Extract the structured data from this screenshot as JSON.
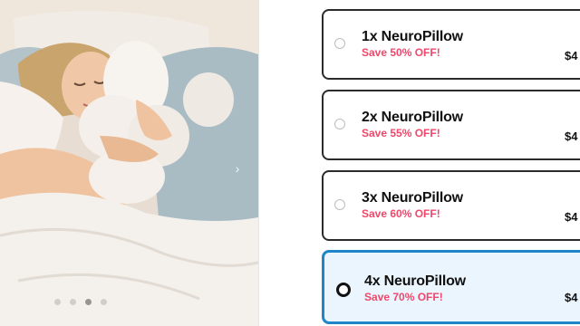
{
  "gallery": {
    "next_arrow": "›",
    "dots": [
      "",
      "",
      "",
      ""
    ],
    "active_dot": 2
  },
  "offers": [
    {
      "title": "1x NeuroPillow",
      "save": "Save 50% OFF!",
      "price": "$4",
      "selected": false
    },
    {
      "title": "2x NeuroPillow",
      "save": "Save 55% OFF!",
      "price": "$4",
      "selected": false
    },
    {
      "title": "3x NeuroPillow",
      "save": "Save 60% OFF!",
      "price": "$4",
      "selected": false
    },
    {
      "title": "4x NeuroPillow",
      "save": "Save 70% OFF!",
      "price": "$4",
      "selected": true
    }
  ],
  "colors": {
    "accent_border": "#1f86c9",
    "selected_bg": "#eaf5fd",
    "save_text": "#f0476b"
  }
}
